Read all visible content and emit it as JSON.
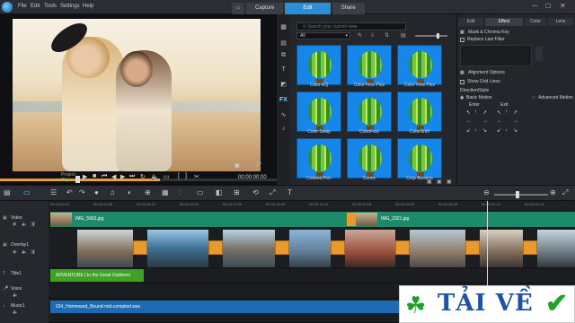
{
  "menu": [
    "File",
    "Edit",
    "Tools",
    "Settings",
    "Help"
  ],
  "window_tabs": {
    "capture": "Capture",
    "edit": "Edit",
    "share": "Share"
  },
  "preview": {
    "project_label": "Project-",
    "clip_label": "Clip-",
    "timecode": "00:00:00:00"
  },
  "library": {
    "search_placeholder": "Search your current view",
    "filter": "All",
    "items": [
      {
        "label": "Color EQ",
        "selected": false
      },
      {
        "label": "Color Fine Plus",
        "selected": false
      },
      {
        "label": "Color Fine Plus",
        "selected": false
      },
      {
        "label": "Color Swap",
        "selected": false
      },
      {
        "label": "ColorFast",
        "selected": false
      },
      {
        "label": "ColorShift",
        "selected": false
      },
      {
        "label": "Colored Pen",
        "selected": false
      },
      {
        "label": "Comic",
        "selected": false
      },
      {
        "label": "Crop Borders",
        "selected": false
      }
    ]
  },
  "effect_panel": {
    "tabs": [
      "Edit",
      "Effect",
      "Color",
      "Lens"
    ],
    "active_tab": "Effect",
    "mask_label": "Mask & Chroma Key",
    "replace_label": "Replace Last Filter",
    "alignment_label": "Alignment Options",
    "show_grid": "Show Grid Lines",
    "direction": "Direction/Style",
    "basic_motion": "Basic Motion",
    "advanced_motion": "Advanced Motion",
    "enter": "Enter",
    "exit": "Exit"
  },
  "timeline": {
    "ticks": [
      "00:00:00:00",
      "00:00:03:06",
      "00:00:06:12",
      "00:00:09:18",
      "00:00:13:00",
      "00:00:16:06",
      "00:00:19:12",
      "00:00:22:18",
      "00:00:25:00",
      "00:00:28:06",
      "00:00:31:12",
      "00:00:34:18"
    ],
    "tracks": [
      "Video",
      "Overlay1",
      "Title1",
      "Voice",
      "Music1"
    ],
    "video_clips": [
      "IMG_5963.jpg",
      "IMG_2321.jpg"
    ],
    "title_clip": "ADVENTURE | In the Great Outdoors",
    "music_clip": "024_Homeward_Bound-mid-compiled.wav"
  },
  "badge": {
    "text": "TẢI VỀ"
  },
  "colors": {
    "accent": "#2a8fd6",
    "video_clip": "#1d8a6c",
    "title_clip": "#3ea323",
    "music_clip": "#1c6bb3",
    "transition": "#e89a2c"
  }
}
